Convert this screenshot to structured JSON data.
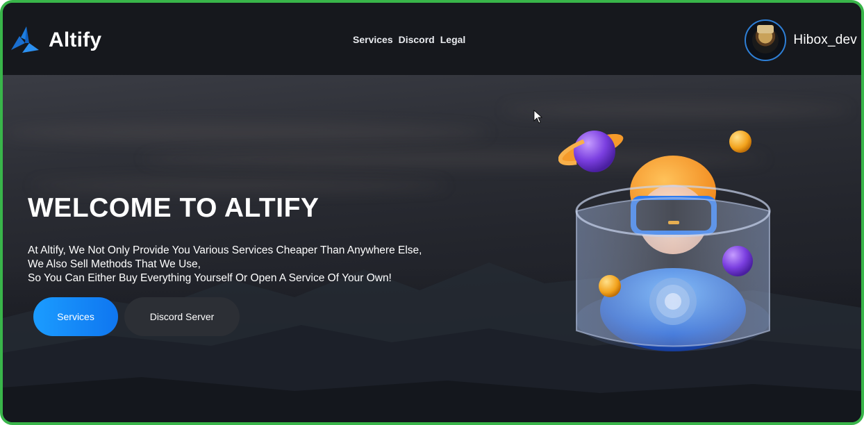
{
  "brand": {
    "name": "Altify"
  },
  "nav": {
    "items": [
      "Services",
      "Discord",
      "Legal"
    ]
  },
  "user": {
    "name": "Hibox_dev"
  },
  "hero": {
    "title": "WELCOME TO ALTIFY",
    "lines": [
      "At Altify, We Not Only Provide You Various Services Cheaper Than Anywhere Else,",
      "We Also Sell Methods That We Use,",
      "So You Can Either Buy Everything Yourself Or Open A Service Of Your Own!"
    ],
    "primary_button": "Services",
    "secondary_button": "Discord Server"
  },
  "colors": {
    "accent": "#1b8cff",
    "frame": "#39b54a",
    "background": "#16181d"
  }
}
